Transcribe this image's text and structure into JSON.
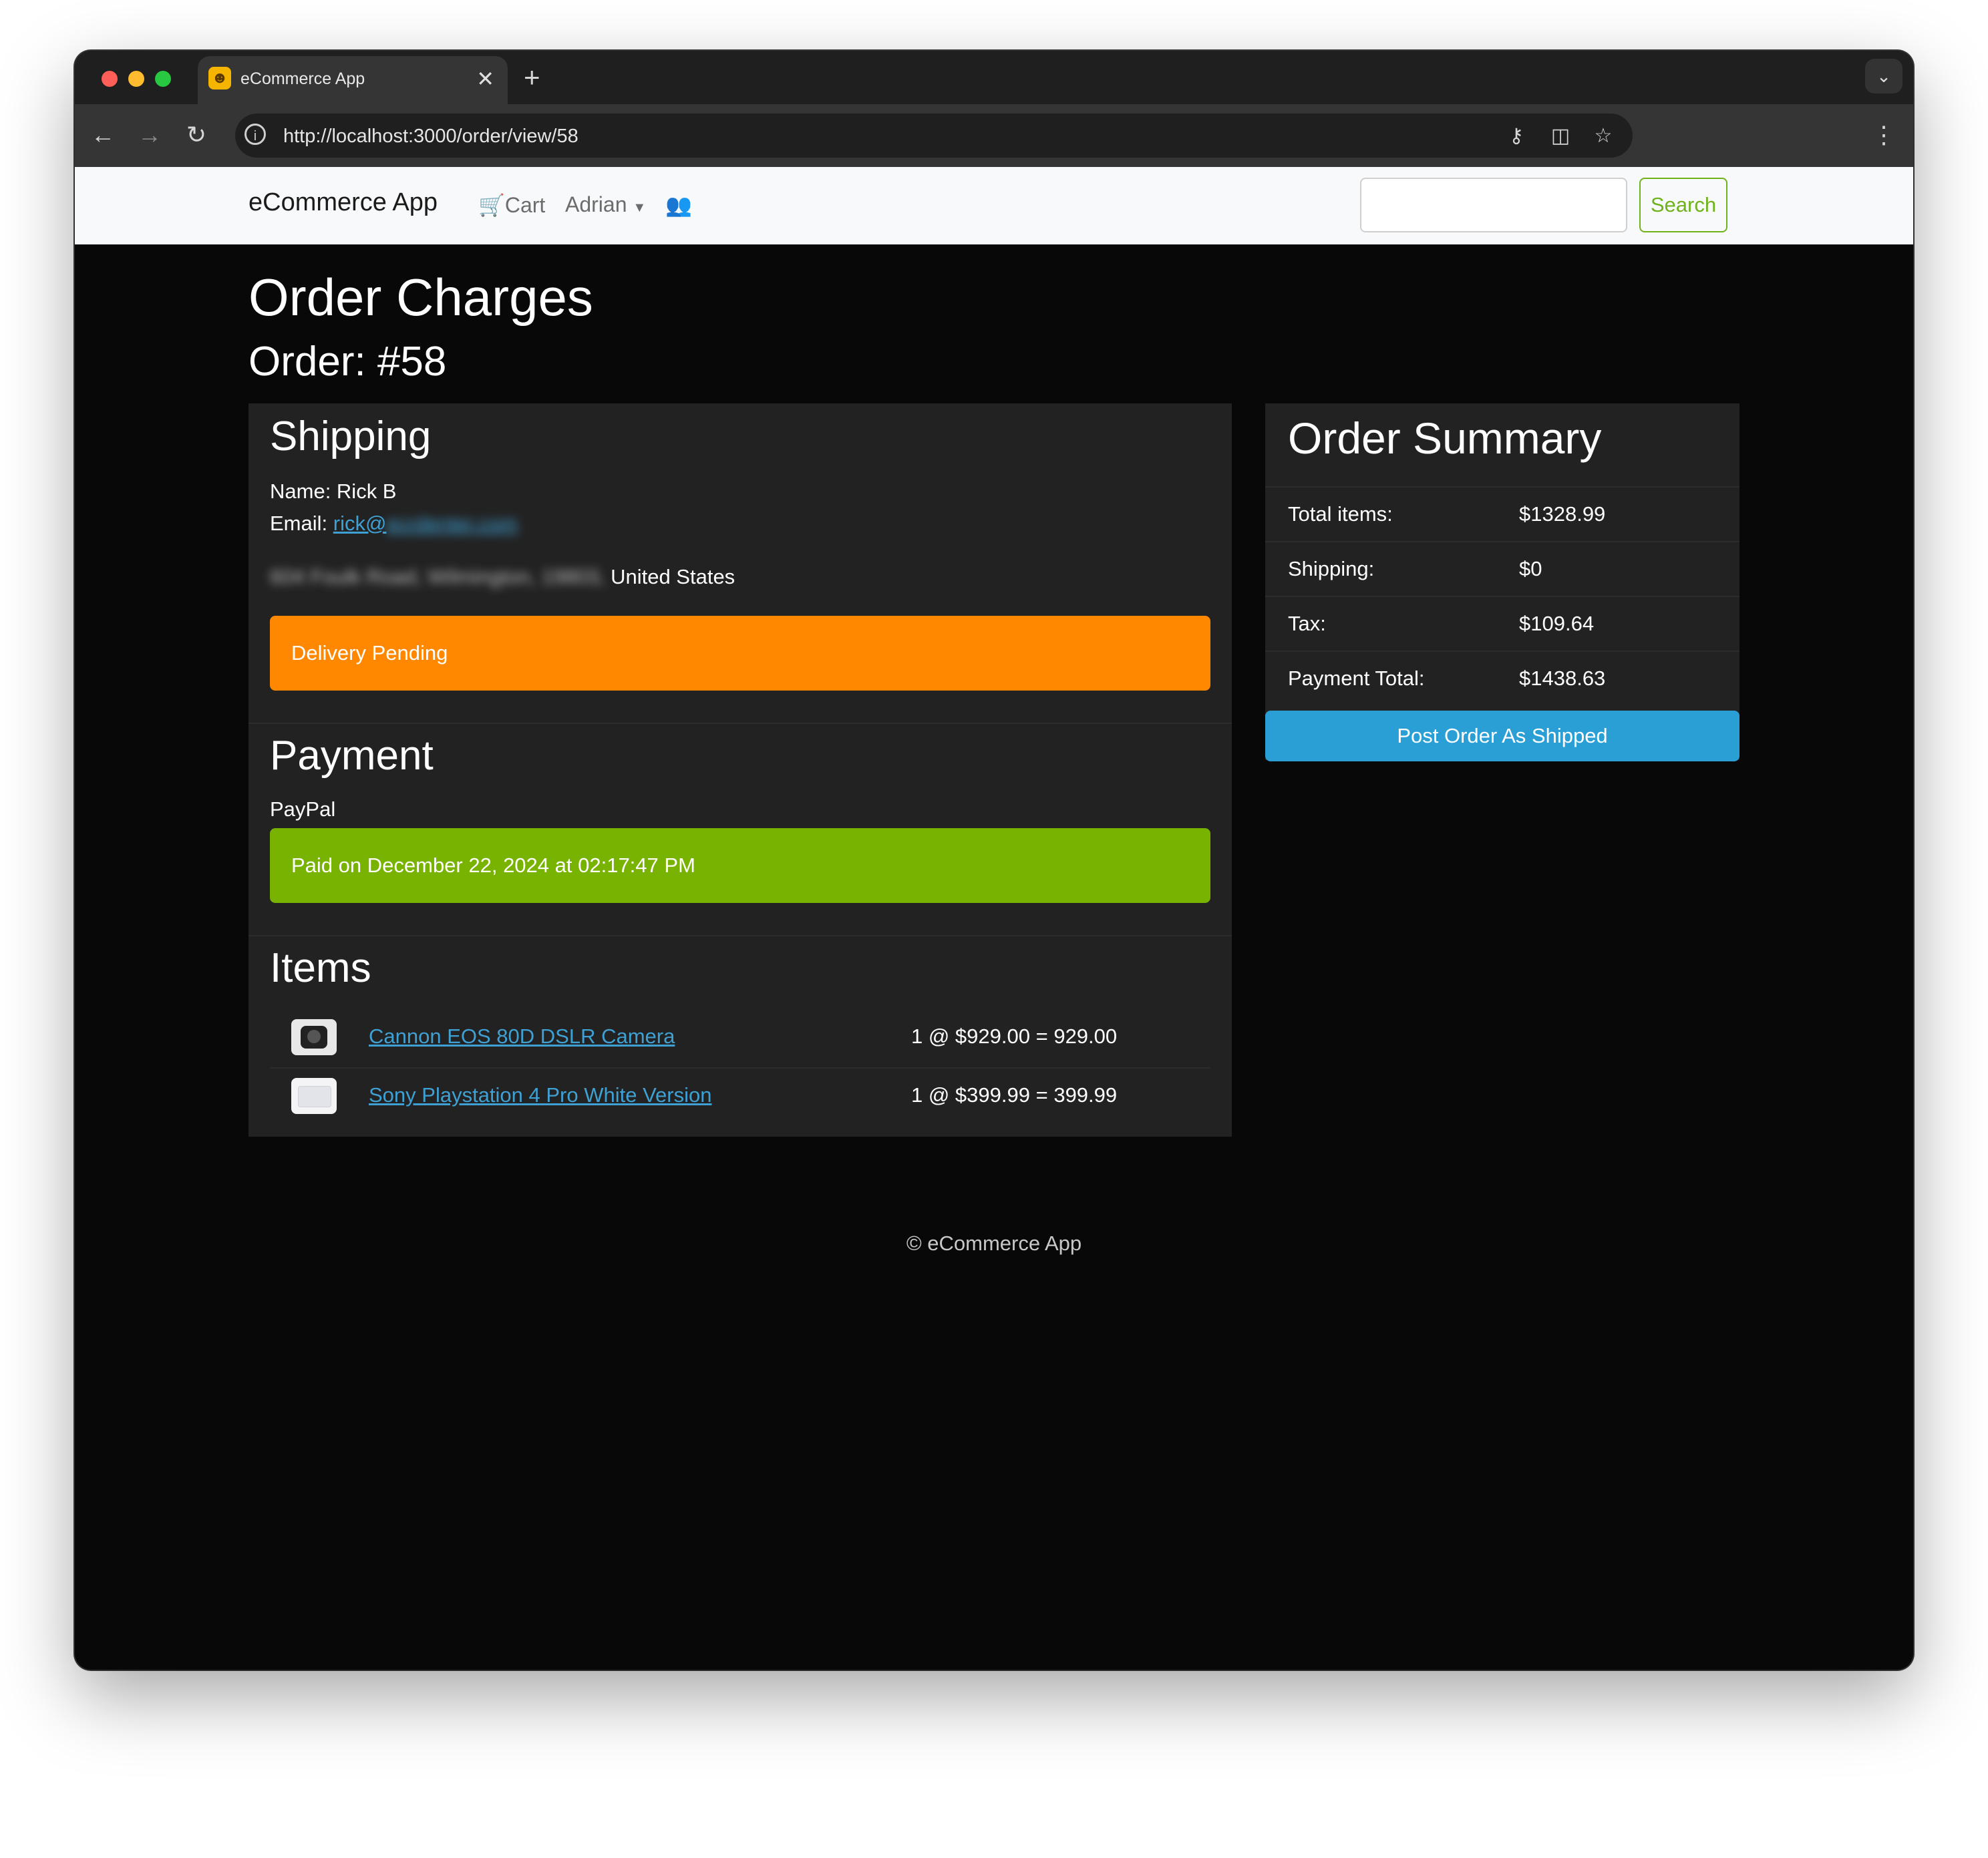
{
  "browser": {
    "tab_title": "eCommerce App",
    "favicon": "cat-emoji-favicon",
    "url": "http://localhost:3000/order/view/58",
    "traffic_colors": {
      "close": "#ff5f57",
      "minimize": "#febc2e",
      "zoom": "#28c840"
    }
  },
  "navbar": {
    "brand": "eCommerce App",
    "cart_label": "Cart",
    "user_label": "Adrian",
    "search_button": "Search",
    "search_placeholder": ""
  },
  "page": {
    "title": "Order Charges",
    "order_label": "Order: #58"
  },
  "shipping": {
    "heading": "Shipping",
    "name_line": "Name: Rick B",
    "email_label": "Email:",
    "email_visible": "rick@",
    "email_redacted": "ecrdenter.com",
    "address_redacted": "604 Foulk Road, Wilmington, 19803,",
    "country": "United States",
    "status": "Delivery Pending"
  },
  "payment": {
    "heading": "Payment",
    "method": "PayPal",
    "status": "Paid on  December 22, 2024 at 02:17:47 PM"
  },
  "items": {
    "heading": "Items",
    "rows": [
      {
        "name": "Cannon EOS 80D DSLR Camera",
        "calc": "1 @ $929.00 = 929.00"
      },
      {
        "name": "Sony Playstation 4 Pro White Version",
        "calc": "1 @ $399.99 = 399.99"
      }
    ]
  },
  "summary": {
    "heading": "Order Summary",
    "rows": [
      {
        "label": "Total items:",
        "value": "$1328.99"
      },
      {
        "label": "Shipping:",
        "value": "$0"
      },
      {
        "label": "Tax:",
        "value": "$109.64"
      },
      {
        "label": "Payment Total:",
        "value": "$1438.63"
      }
    ],
    "button": "Post Order As Shipped"
  },
  "footer": "© eCommerce App",
  "colors": {
    "delivery_pending": "#ff8800",
    "paid": "#77b300",
    "primary": "#2a9fd6",
    "link": "#3fa0d4",
    "card": "#222222",
    "page_bg": "#080808"
  }
}
